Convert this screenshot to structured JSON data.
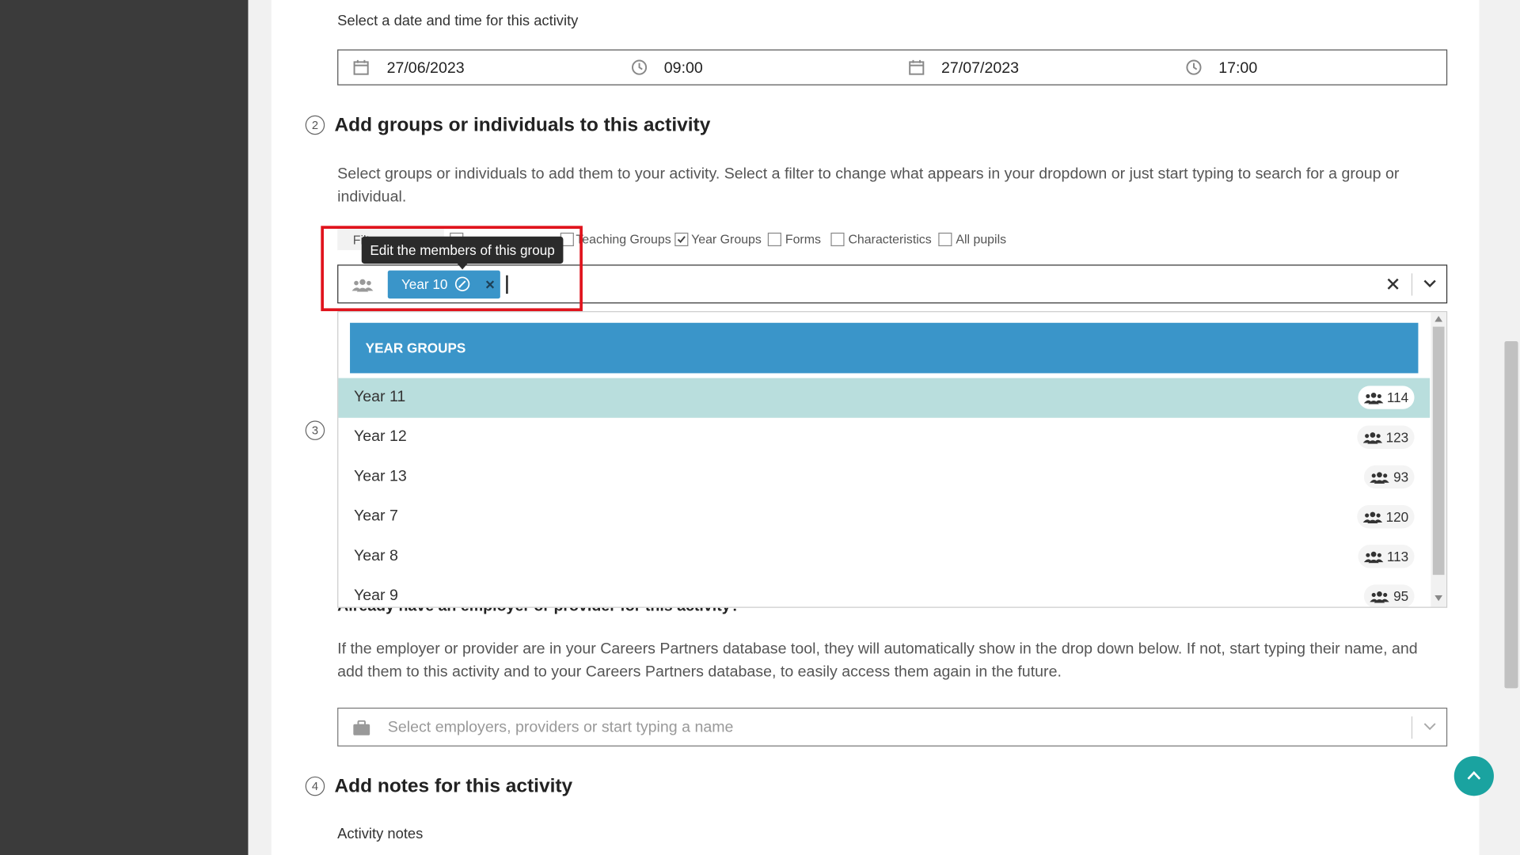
{
  "section1": {
    "prompt": "Select a date and time for this activity",
    "start_date": "27/06/2023",
    "start_time": "09:00",
    "end_date": "27/07/2023",
    "end_time": "17:00"
  },
  "section2": {
    "step": "2",
    "title": "Add groups or individuals to this activity",
    "description": "Select groups or individuals to add them to your activity. Select a filter to change what appears in your dropdown or just start typing to search for a group or individual.",
    "filter_label": "Filter...",
    "filters": [
      {
        "label": "Teaching Groups",
        "checked": false
      },
      {
        "label": "Year Groups",
        "checked": true
      },
      {
        "label": "Forms",
        "checked": false
      },
      {
        "label": "Characteristics",
        "checked": false
      },
      {
        "label": "All pupils",
        "checked": false
      }
    ],
    "selected_chip": "Year 10",
    "tooltip": "Edit the members of this group",
    "dropdown": {
      "group_header": "YEAR GROUPS",
      "items": [
        {
          "label": "Year 11",
          "count": "114"
        },
        {
          "label": "Year 12",
          "count": "123"
        },
        {
          "label": "Year 13",
          "count": "93"
        },
        {
          "label": "Year 7",
          "count": "120"
        },
        {
          "label": "Year 8",
          "count": "113"
        },
        {
          "label": "Year 9",
          "count": "95"
        }
      ]
    }
  },
  "section3": {
    "step": "3",
    "question": "Already have an employer or provider for this activity?",
    "description": "If the employer or provider are in your Careers Partners database tool, they will automatically show in the drop down below. If not, start typing their name, and add them to this activity and to your Careers Partners database, to easily access them again in the future.",
    "placeholder": "Select employers, providers or start typing a name"
  },
  "section4": {
    "step": "4",
    "title": "Add notes for this activity",
    "notes_label": "Activity notes"
  },
  "colors": {
    "accent_blue": "#3a95c9",
    "row_highlight": "#b9dedd",
    "highlight_frame": "#e0131c",
    "back_to_top": "#1aa3a0"
  }
}
